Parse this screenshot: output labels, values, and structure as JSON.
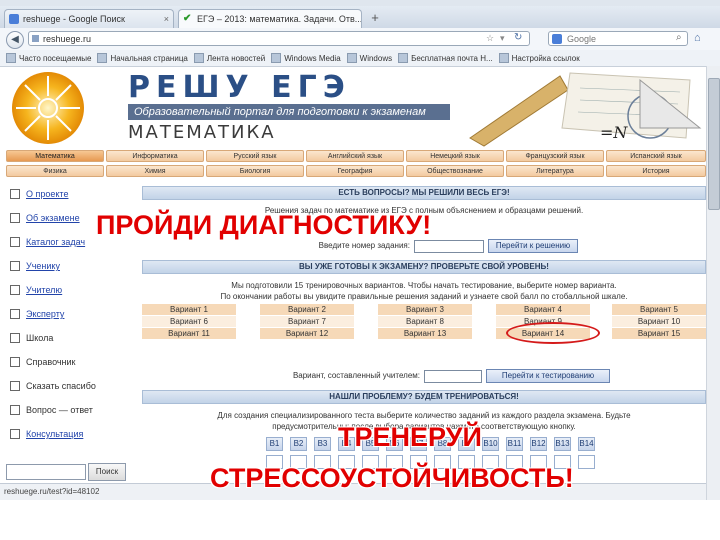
{
  "browser": {
    "tabs": [
      {
        "label": "reshuege - Google Поиск"
      },
      {
        "label": "ЕГЭ – 2013: математика. Задачи. Отв..."
      }
    ],
    "new_tab": "+",
    "url": "reshuege.ru",
    "search_placeholder": "Google",
    "bookmarks": [
      "Часто посещаемые",
      "Начальная страница",
      "Лента новостей",
      "Windows Media",
      "Windows",
      "Бесплатная почта H...",
      "Настройка ссылок"
    ],
    "status_url": "reshuege.ru/test?id=48102"
  },
  "header": {
    "title": "РЕШУ ЕГЭ",
    "tagline": "Образовательный портал для подготовки к экзаменам",
    "subject": "МАТЕМАТИКА",
    "deco_formula": "=N"
  },
  "subjects": {
    "row1": [
      "Математика",
      "Информатика",
      "Русский язык",
      "Английский язык",
      "Немецкий язык",
      "Французский язык",
      "Испанский язык"
    ],
    "row2": [
      "Физика",
      "Химия",
      "Биология",
      "География",
      "Обществознание",
      "Литература",
      "История"
    ],
    "active": "Математика"
  },
  "sidebar": {
    "items": [
      {
        "label": "О проекте",
        "link": true
      },
      {
        "label": "Об экзамене",
        "link": true
      },
      {
        "label": "Каталог задач",
        "link": true
      },
      {
        "label": "Ученику",
        "link": true
      },
      {
        "label": "Учителю",
        "link": true
      },
      {
        "label": "Эксперту",
        "link": true
      },
      {
        "label": "Школа",
        "link": false
      },
      {
        "label": "Справочник",
        "link": false
      },
      {
        "label": "Сказать спасибо",
        "link": false
      },
      {
        "label": "Вопрос — ответ",
        "link": false
      },
      {
        "label": "Консультация",
        "link": true
      }
    ],
    "search_button": "Поиск"
  },
  "main": {
    "bar1": "ЕСТЬ ВОПРОСЫ? МЫ РЕШИЛИ ВЕСЬ ЕГЭ!",
    "bar1_text": "Решения задач по математике из ЕГЭ с полным объяснением и образцами решений.",
    "task_label": "Введите номер задания:",
    "task_button": "Перейти к решению",
    "bar2": "ВЫ УЖЕ ГОТОВЫ К ЭКЗАМЕНУ? ПРОВЕРЬТЕ СВОЙ УРОВЕНЬ!",
    "bar2_line1": "Мы подготовили 15 тренировочных вариантов. Чтобы начать тестирование, выберите номер варианта.",
    "bar2_line2": "По окончании работы вы увидите правильные решения заданий и узнаете свой балл по стобалльной шкале.",
    "variants": [
      [
        "Вариант 1",
        "Вариант 2",
        "Вариант 3",
        "Вариант 4",
        "Вариант 5"
      ],
      [
        "Вариант 6",
        "Вариант 7",
        "Вариант 8",
        "Вариант 9",
        "Вариант 10"
      ],
      [
        "Вариант 11",
        "Вариант 12",
        "Вариант 13",
        "Вариант 14",
        "Вариант 15"
      ]
    ],
    "teacher_label": "Вариант, составленный учителем:",
    "teacher_button": "Перейти к тестированию",
    "bar3": "НАШЛИ ПРОБЛЕМУ? БУДЕМ ТРЕНИРОВАТЬСЯ!",
    "bar3_line1": "Для создания специализированного теста выберите количество заданий из каждого раздела экзамена. Будьте",
    "bar3_line2": "предусмотрительны: после выбора вариантов нажмите соответствующую кнопку.",
    "task_types": [
      "B1",
      "B2",
      "B3",
      "B4",
      "B5",
      "B6",
      "B7",
      "B8",
      "B9",
      "B10",
      "B11",
      "B12",
      "B13",
      "B14"
    ]
  },
  "overlays": {
    "top": "ПРОЙДИ ДИАГНОСТИКУ!",
    "mid": "ТРЕНЕРУЙ",
    "bottom": "СТРЕССОУСТОЙЧИВОСТЬ!"
  },
  "colors": {
    "overlay_text": "#e10000",
    "title_blue": "#2b4f86",
    "tab_orange": "#f3caa0",
    "bar_blue": "#c2d3e8"
  }
}
